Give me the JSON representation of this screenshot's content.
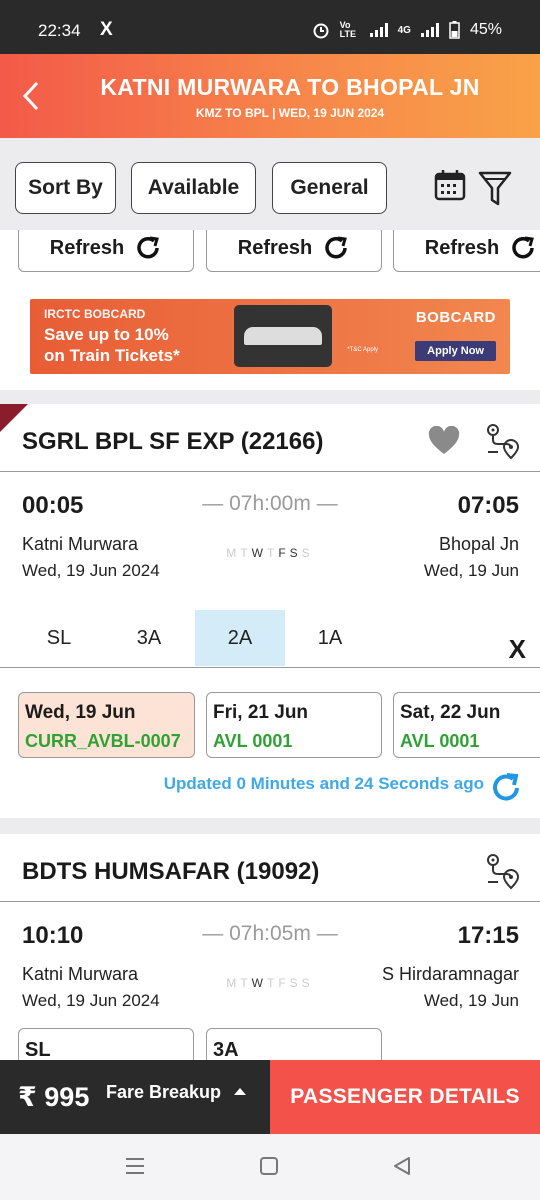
{
  "status": {
    "time": "22:34",
    "x_icon": "X",
    "volte": "Vo LTE",
    "network": "4G",
    "battery": "45%"
  },
  "header": {
    "back_icon": "back-chevron",
    "title": "KATNI MURWARA TO BHOPAL  JN",
    "subtitle": "KMZ TO BPL | WED, 19 JUN  2024"
  },
  "filters": {
    "sort_by": "Sort By",
    "available": "Available",
    "general": "General",
    "calendar_icon": "calendar-icon",
    "filter_icon": "funnel-icon"
  },
  "refresh": {
    "label": "Refresh"
  },
  "banner": {
    "line1": "IRCTC BOBCARD",
    "line2": "Save up to 10%",
    "line3": "on Train Tickets*",
    "brand": "BOBCARD",
    "cta": "Apply Now",
    "tc": "*T&C Apply"
  },
  "train1": {
    "name": "SGRL BPL SF EXP (22166)",
    "dep_time": "00:05",
    "arr_time": "07:05",
    "duration": "— 07h:00m —",
    "from": "Katni Murwara",
    "to": "Bhopal  Jn",
    "dep_date": "Wed, 19 Jun  2024",
    "arr_date": "Wed, 19 Jun",
    "days": [
      "M",
      "T",
      "W",
      "T",
      "F",
      "S",
      "S"
    ],
    "classes": [
      "SL",
      "3A",
      "2A",
      "1A"
    ],
    "close": "X",
    "availability": [
      {
        "date": "Wed, 19 Jun",
        "status": "CURR_AVBL-0007"
      },
      {
        "date": "Fri, 21 Jun",
        "status": "AVL 0001"
      },
      {
        "date": "Sat, 22 Jun",
        "status": "AVL 0001"
      }
    ],
    "updated": "Updated 0 Minutes and 24 Seconds ago"
  },
  "train2": {
    "name": "BDTS HUMSAFAR (19092)",
    "dep_time": "10:10",
    "arr_time": "17:15",
    "duration": "— 07h:05m —",
    "from": "Katni Murwara",
    "to": "S Hirdaramnagar",
    "dep_date": "Wed, 19 Jun  2024",
    "arr_date": "Wed, 19 Jun",
    "days": [
      "M",
      "T",
      "W",
      "T",
      "F",
      "S",
      "S"
    ],
    "classes": [
      "SL",
      "3A"
    ]
  },
  "footer": {
    "fare": "₹ 995",
    "fare_breakup": "Fare Breakup",
    "passenger_details": "PASSENGER DETAILS"
  },
  "colors": {
    "header_start": "#f35a49",
    "header_end": "#f9a248",
    "accent_red": "#f35149",
    "avl_green": "#30a234",
    "updated_blue": "#3fa9e5",
    "selected_class": "#d3ecf8"
  }
}
